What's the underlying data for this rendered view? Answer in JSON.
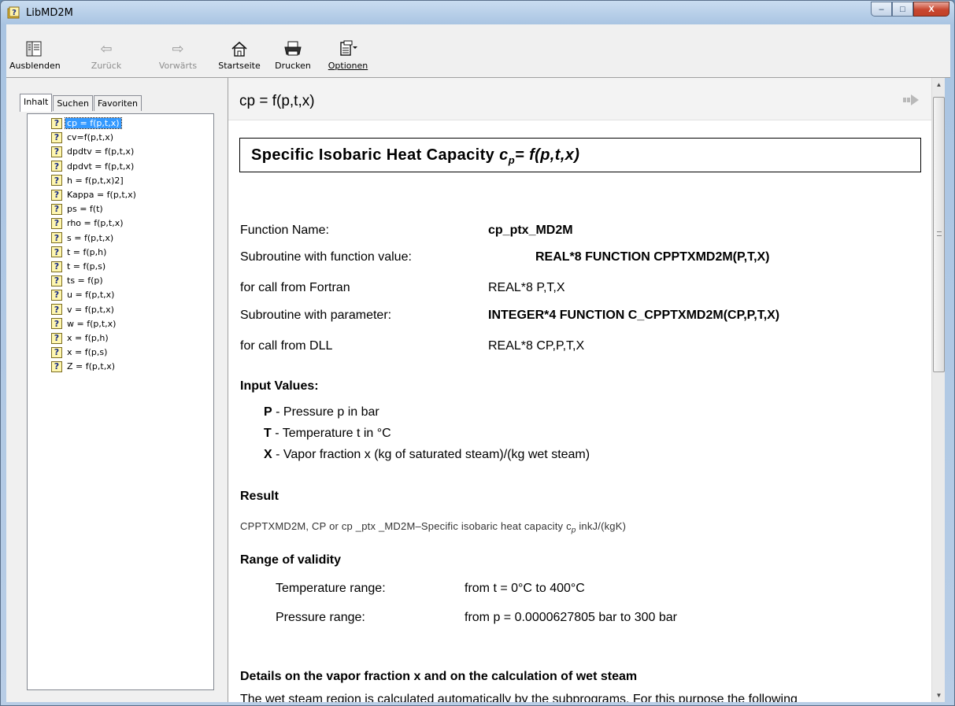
{
  "window": {
    "title": "LibMD2M",
    "buttons": {
      "minimize": "–",
      "maximize": "□",
      "close": "X"
    }
  },
  "toolbar": {
    "hide": "Ausblenden",
    "back": "Zurück",
    "forward": "Vorwärts",
    "home": "Startseite",
    "print": "Drucken",
    "options": "Optionen"
  },
  "tabs": {
    "contents": "Inhalt",
    "search": "Suchen",
    "favorites": "Favoriten"
  },
  "tree": [
    "cp = f(p,t,x)",
    "cv=f(p,t,x)",
    "dpdtv = f(p,t,x)",
    "dpdvt = f(p,t,x)",
    "h = f(p,t,x)2]",
    "Kappa = f(p,t,x)",
    "ps = f(t)",
    "rho = f(p,t,x)",
    "s = f(p,t,x)",
    "t = f(p,h)",
    "t = f(p,s)",
    "ts = f(p)",
    "u = f(p,t,x)",
    "v = f(p,t,x)",
    "w = f(p,t,x)",
    "x = f(p,h)",
    "x = f(p,s)",
    "Z = f(p,t,x)"
  ],
  "content": {
    "topic_title": "cp = f(p,t,x)",
    "heading_text": "Specific Isobaric Heat Capacity",
    "heading_formula": "c",
    "heading_sub": "p",
    "heading_rest": "= f(p,t,x)",
    "rows": {
      "fn_label": "Function Name:",
      "fn_value": "cp_ptx_MD2M",
      "sub_fv_label": "Subroutine with function value:",
      "sub_fv_value": "REAL*8 FUNCTION CPPTXMD2M(P,T,X)",
      "fortran_label": "for call from Fortran",
      "fortran_value": "REAL*8 P,T,X",
      "sub_p_label": "Subroutine with parameter:",
      "sub_p_value": "INTEGER*4 FUNCTION C_CPPTXMD2M(CP,P,T,X)",
      "dll_label": "for call from DLL",
      "dll_value": "REAL*8 CP,P,T,X"
    },
    "input_title": "Input Values:",
    "inputs": [
      {
        "key": "P",
        "text": "- Pressure p in bar"
      },
      {
        "key": "T",
        "text": "- Temperature t in °C"
      },
      {
        "key": "X",
        "text": "- Vapor fraction x (kg of saturated steam)/(kg wet steam)"
      }
    ],
    "result_title": "Result",
    "result_text": "CPPTXMD2M, CP or cp _ptx _MD2M–Specific isobaric heat capacity c",
    "result_sub": "p",
    "result_unit": " inkJ/(kgK)",
    "range_title": "Range of validity",
    "temp_label": "Temperature range:",
    "temp_value": "from  t  =  0°C  to  400°C",
    "pres_label": "Pressure range:",
    "pres_value": "from  p =  0.0000627805 bar to 300 bar",
    "details_title": "Details on the vapor fraction x and on the calculation of wet steam",
    "details_text": "The wet steam region is calculated automatically by the subprograms. For this purpose the following"
  }
}
